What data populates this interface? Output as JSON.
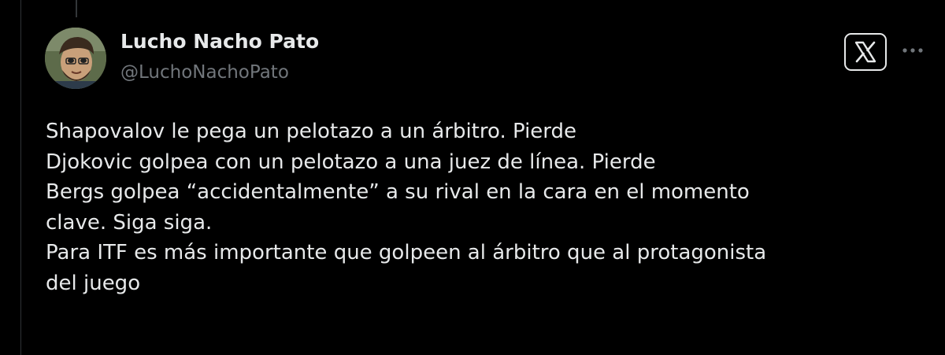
{
  "author": {
    "display_name": "Lucho Nacho Pato",
    "handle": "@LuchoNachoPato"
  },
  "icons": {
    "avatar": "profile-photo",
    "logo": "x-logo-icon",
    "more": "more-horizontal-icon"
  },
  "tweet": {
    "lines": [
      "Shapovalov le pega un pelotazo a un árbitro. Pierde",
      "Djokovic golpea con un pelotazo a una juez de línea. Pierde",
      "Bergs golpea “accidentalmente” a su rival en la cara en el momento",
      "clave. Siga siga.",
      "Para ITF es más importante que golpeen al árbitro que al protagonista",
      "del juego"
    ]
  },
  "colors": {
    "background": "#000000",
    "text_primary": "#e7e9ea",
    "text_secondary": "#71767b"
  }
}
